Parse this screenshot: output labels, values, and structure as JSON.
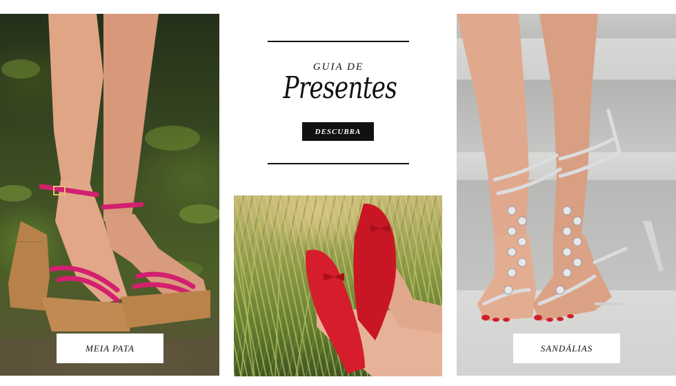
{
  "promo": {
    "kicker": "GUIA DE",
    "title": "Presentes",
    "cta_label": "DESCUBRA"
  },
  "panels": {
    "left": {
      "label": "MEIA PATA"
    },
    "right": {
      "label": "SANDÁLIAS"
    }
  },
  "colors": {
    "rule": "#111111",
    "button_bg": "#111111",
    "button_text": "#ffffff",
    "shoe_pink": "#d2206f",
    "shoe_red": "#d61d2b",
    "shoe_silver": "#d9d9dc"
  }
}
